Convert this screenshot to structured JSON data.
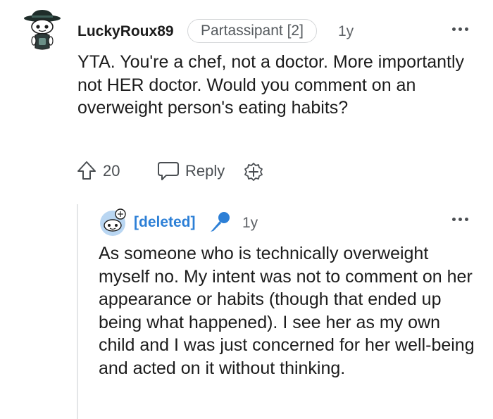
{
  "comment": {
    "username": "LuckyRoux89",
    "flair": "Partassipant [2]",
    "age": "1y",
    "body": "YTA. You're a chef, not a doctor. More importantly not HER doctor. Would you comment on an overweight person's eating habits?",
    "votes": "20",
    "reply_label": "Reply",
    "more_icon": "more-options-icon",
    "upvote_icon": "upvote-arrow-icon",
    "reply_icon": "speech-bubble-icon",
    "award_icon": "award-plus-icon"
  },
  "reply": {
    "username": "[deleted]",
    "age": "1y",
    "body": "As someone who is technically overweight myself no. My intent was not to comment on her appearance or habits (though that ended up being what happened). I see her as my own child and I was just concerned for her well-being and acted on it without thinking.",
    "more_icon": "more-options-icon",
    "badge_icon": "microphone-icon"
  },
  "colors": {
    "text": "#1c1c1c",
    "meta": "#5f6368",
    "deleted_user": "#2c7fd6",
    "mic_badge": "#2c7fd6",
    "thread_line": "#e4e6e8"
  }
}
